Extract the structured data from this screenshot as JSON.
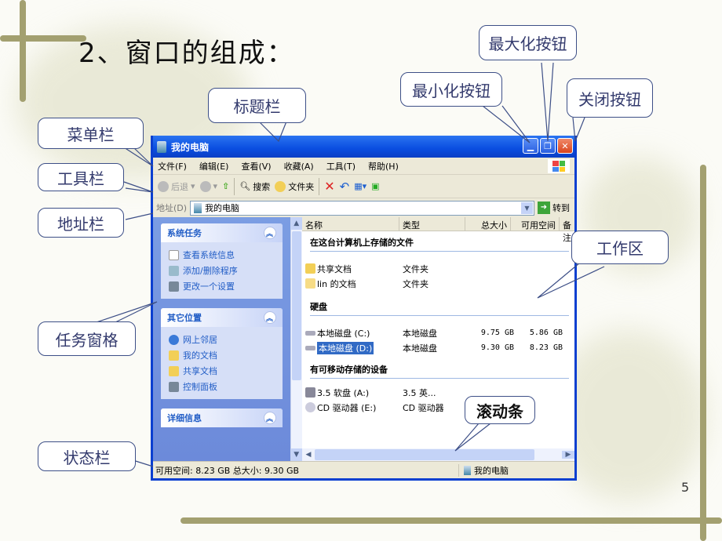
{
  "slide": {
    "title": "2、窗口的组成：",
    "page_number": "5"
  },
  "callouts": {
    "title_bar": "标题栏",
    "menu_bar": "菜单栏",
    "toolbar": "工具栏",
    "address_bar": "地址栏",
    "task_pane": "任务窗格",
    "status_bar": "状态栏",
    "minimize": "最小化按钮",
    "maximize": "最大化按钮",
    "close": "关闭按钮",
    "work_area": "工作区",
    "scrollbar": "滚动条"
  },
  "window": {
    "title": "我的电脑",
    "menu": [
      "文件(F)",
      "编辑(E)",
      "查看(V)",
      "收藏(A)",
      "工具(T)",
      "帮助(H)"
    ],
    "toolbar": {
      "back": "后退",
      "search": "搜索",
      "folders": "文件夹"
    },
    "address": {
      "label": "地址(D)",
      "value": "我的电脑",
      "go": "转到"
    },
    "task_pane": {
      "panels": [
        {
          "title": "系统任务",
          "items": [
            "查看系统信息",
            "添加/删除程序",
            "更改一个设置"
          ]
        },
        {
          "title": "其它位置",
          "items": [
            "网上邻居",
            "我的文档",
            "共享文档",
            "控制面板"
          ]
        },
        {
          "title": "详细信息",
          "items": []
        }
      ]
    },
    "columns": [
      "名称",
      "类型",
      "总大小",
      "可用空间",
      "备注"
    ],
    "groups": [
      {
        "title": "在这台计算机上存储的文件",
        "rows": [
          {
            "name": "共享文档",
            "type": "文件夹",
            "size": "",
            "free": ""
          },
          {
            "name": "lin 的文档",
            "type": "文件夹",
            "size": "",
            "free": ""
          }
        ]
      },
      {
        "title": "硬盘",
        "rows": [
          {
            "name": "本地磁盘 (C:)",
            "type": "本地磁盘",
            "size": "9.75 GB",
            "free": "5.86 GB"
          },
          {
            "name": "本地磁盘 (D:)",
            "type": "本地磁盘",
            "size": "9.30 GB",
            "free": "8.23 GB"
          }
        ]
      },
      {
        "title": "有可移动存储的设备",
        "rows": [
          {
            "name": "3.5 软盘 (A:)",
            "type": "3.5 英...",
            "size": "",
            "free": ""
          },
          {
            "name": "CD 驱动器 (E:)",
            "type": "CD 驱动器",
            "size": "",
            "free": ""
          }
        ]
      }
    ],
    "status": {
      "left": "可用空间: 8.23 GB 总大小: 9.30 GB",
      "right": "我的电脑"
    }
  }
}
